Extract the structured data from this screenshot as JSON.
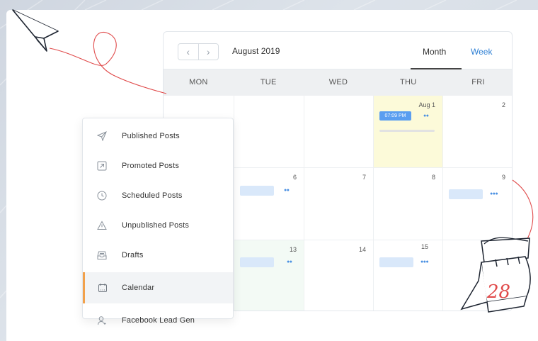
{
  "calendar": {
    "month_label": "August 2019",
    "tabs": {
      "month": "Month",
      "week": "Week"
    },
    "weekdays": [
      "MON",
      "TUE",
      "WED",
      "THU",
      "FRI"
    ],
    "days": {
      "aug1": "Aug 1",
      "d2": "2",
      "d6": "6",
      "d7": "7",
      "d8": "8",
      "d9": "9",
      "d13": "13",
      "d14": "14",
      "d15": "15"
    },
    "event_time": "07:09 PM",
    "nav": {
      "prev": "‹",
      "next": "›"
    }
  },
  "menu": {
    "items": [
      {
        "label": "Published Posts",
        "icon": "paper-plane-icon"
      },
      {
        "label": "Promoted Posts",
        "icon": "arrow-up-right-box-icon"
      },
      {
        "label": "Scheduled Posts",
        "icon": "clock-icon"
      },
      {
        "label": "Unpublished Posts",
        "icon": "warning-icon"
      },
      {
        "label": "Drafts",
        "icon": "inbox-icon"
      },
      {
        "label": "Calendar",
        "icon": "calendar-icon"
      },
      {
        "label": "Facebook Lead Gen",
        "icon": "user-icon"
      }
    ],
    "active_index": 5
  },
  "illustration": {
    "calendar_page_number": "28"
  },
  "colors": {
    "accent_blue": "#2d7fd4",
    "active_border": "#f2a14b",
    "today_bg": "#fcfad9",
    "deco_red": "#e04a4a"
  }
}
